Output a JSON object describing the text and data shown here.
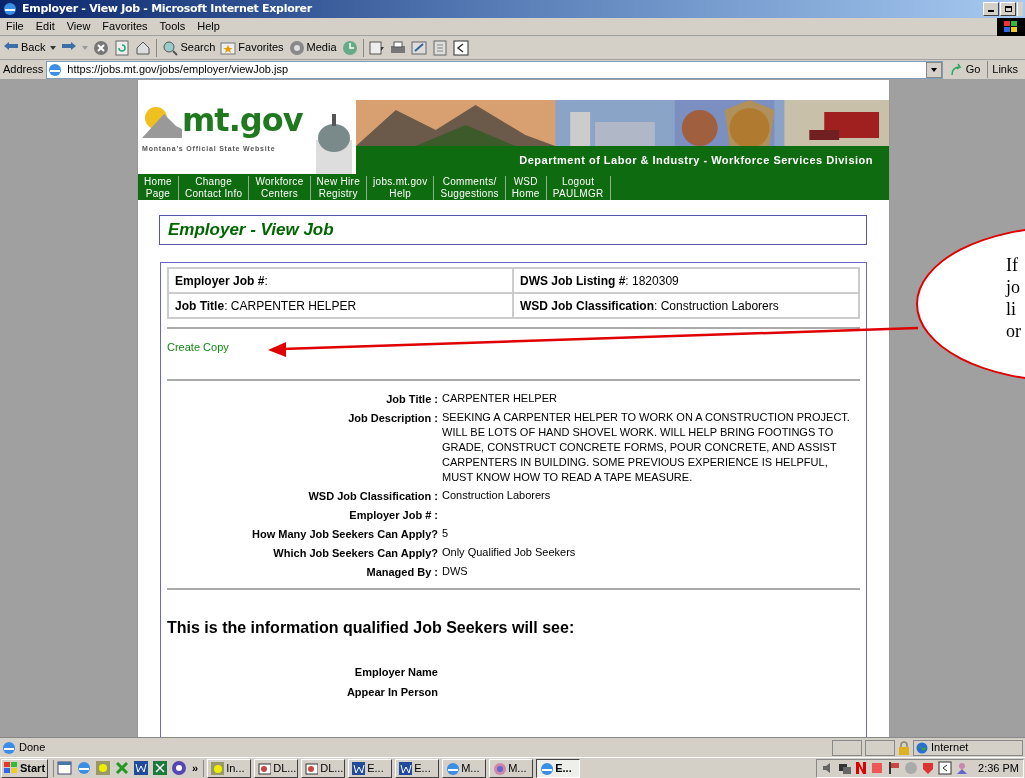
{
  "window": {
    "title": "Employer - View Job - Microsoft Internet Explorer"
  },
  "menu": [
    "File",
    "Edit",
    "View",
    "Favorites",
    "Tools",
    "Help"
  ],
  "toolbar": [
    {
      "kind": "back",
      "label": "Back"
    },
    {
      "kind": "forward"
    },
    {
      "kind": "stop"
    },
    {
      "kind": "refresh"
    },
    {
      "kind": "home"
    },
    {
      "kind": "search",
      "label": "Search"
    },
    {
      "kind": "favorites",
      "label": "Favorites"
    },
    {
      "kind": "media",
      "label": "Media"
    },
    {
      "kind": "history"
    },
    {
      "kind": "mail"
    },
    {
      "kind": "print"
    },
    {
      "kind": "edit"
    },
    {
      "kind": "discuss"
    },
    {
      "kind": "messenger"
    }
  ],
  "address": {
    "label": "Address",
    "url": "https://jobs.mt.gov/jobs/employer/viewJob.jsp",
    "go": "Go",
    "links": "Links"
  },
  "banner": {
    "logo": "mt.gov",
    "tagline": "Montana's Official State Website",
    "department": "Department of Labor & Industry - Workforce Services Division"
  },
  "nav": [
    [
      "Home",
      "Page"
    ],
    [
      "Change",
      "Contact Info"
    ],
    [
      "Workforce",
      "Centers"
    ],
    [
      "New Hire",
      "Registry"
    ],
    [
      "jobs.mt.gov",
      "Help"
    ],
    [
      "Comments/",
      "Suggestions"
    ],
    [
      "WSD",
      "Home"
    ],
    [
      "Logout",
      "PAULMGR"
    ]
  ],
  "page_title": "Employer - View Job",
  "summary": [
    [
      "**Employer Job #**:",
      "**DWS Job Listing #**: 1820309"
    ],
    [
      "**Job Title**: CARPENTER HELPER",
      "**WSD Job Classification**: Construction Laborers"
    ]
  ],
  "create_copy": "Create Copy",
  "details": [
    {
      "label": "Job Title :",
      "value": "CARPENTER HELPER"
    },
    {
      "label": "Job Description :",
      "value": "SEEKING A CARPENTER HELPER TO WORK ON A CONSTRUCTION PROJECT. WILL BE LOTS OF HAND SHOVEL WORK. WILL HELP BRING FOOTINGS TO GRADE, CONSTRUCT CONCRETE FORMS, POUR CONCRETE, AND ASSIST CARPENTERS IN BUILDING. SOME PREVIOUS EXPERIENCE IS HELPFUL, MUST KNOW HOW TO READ A TAPE MEASURE."
    },
    {
      "label": "WSD Job Classification :",
      "value": "Construction Laborers"
    },
    {
      "label": "Employer Job # :"
    },
    {
      "label": "How Many Job Seekers Can Apply?",
      "value": "5"
    },
    {
      "label": "Which Job Seekers Can Apply?",
      "value": "Only Qualified Job Seekers"
    },
    {
      "label": "Managed By :",
      "value": "DWS"
    }
  ],
  "seeker_heading": "This is the information qualified Job Seekers will see:",
  "seeker_fields": [
    "Employer Name",
    "Appear In Person"
  ],
  "callout": {
    "lines": [
      "If",
      "jo",
      "li",
      "or"
    ]
  },
  "status_bar": {
    "text": "Done",
    "zone": "Internet"
  },
  "taskbar": {
    "start": "Start",
    "more": "»",
    "tasks": [
      {
        "label": "In...",
        "selected": false
      },
      {
        "label": "DL...",
        "selected": false
      },
      {
        "label": "DL...",
        "selected": false
      },
      {
        "label": "E...",
        "selected": false
      },
      {
        "label": "E...",
        "selected": false
      },
      {
        "label": "M...",
        "selected": false
      },
      {
        "label": "M...",
        "selected": false
      },
      {
        "label": "E...",
        "selected": true
      }
    ],
    "time": "2:36 PM"
  }
}
